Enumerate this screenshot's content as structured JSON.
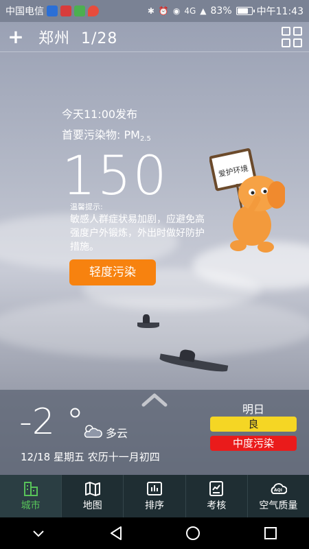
{
  "status_bar": {
    "carrier": "中国电信",
    "network": "4G",
    "battery": "83%",
    "battery_level": 0.83,
    "time": "中午11:43"
  },
  "header": {
    "add_label": "+",
    "city": "郑州",
    "page": "1/28"
  },
  "aqi": {
    "publish_time": "今天11:00发布",
    "pollutant_label": "首要污染物: PM",
    "pollutant_sub": "2.5",
    "value": "150",
    "tip_title": "温馨提示:",
    "tip_text": "敏感人群症状易加剧，应避免高强度户外锻炼，外出时做好防护措施。",
    "level_label": "轻度污染",
    "level_color": "#f7820f"
  },
  "mascot": {
    "sign_text": "爱护环境"
  },
  "weather": {
    "temperature": "-2 °",
    "condition": "多云",
    "condition_icon": "partly-cloudy-icon",
    "date": "12/18  星期五  农历十一月初四"
  },
  "tomorrow": {
    "title": "明日",
    "levels": [
      {
        "label": "良",
        "color": "#f5d624"
      },
      {
        "label": "中度污染",
        "color": "#ea1b1b"
      }
    ]
  },
  "tabs": [
    {
      "label": "城市",
      "icon": "city-buildings-icon",
      "active": true
    },
    {
      "label": "地图",
      "icon": "map-icon",
      "active": false
    },
    {
      "label": "排序",
      "icon": "ranking-chart-icon",
      "active": false
    },
    {
      "label": "考核",
      "icon": "assessment-chart-icon",
      "active": false
    },
    {
      "label": "空气质量",
      "icon": "aqi-cloud-icon",
      "active": false
    }
  ],
  "colors": {
    "accent_green": "#58c35a",
    "tabbar_bg": "#1f2e33"
  }
}
